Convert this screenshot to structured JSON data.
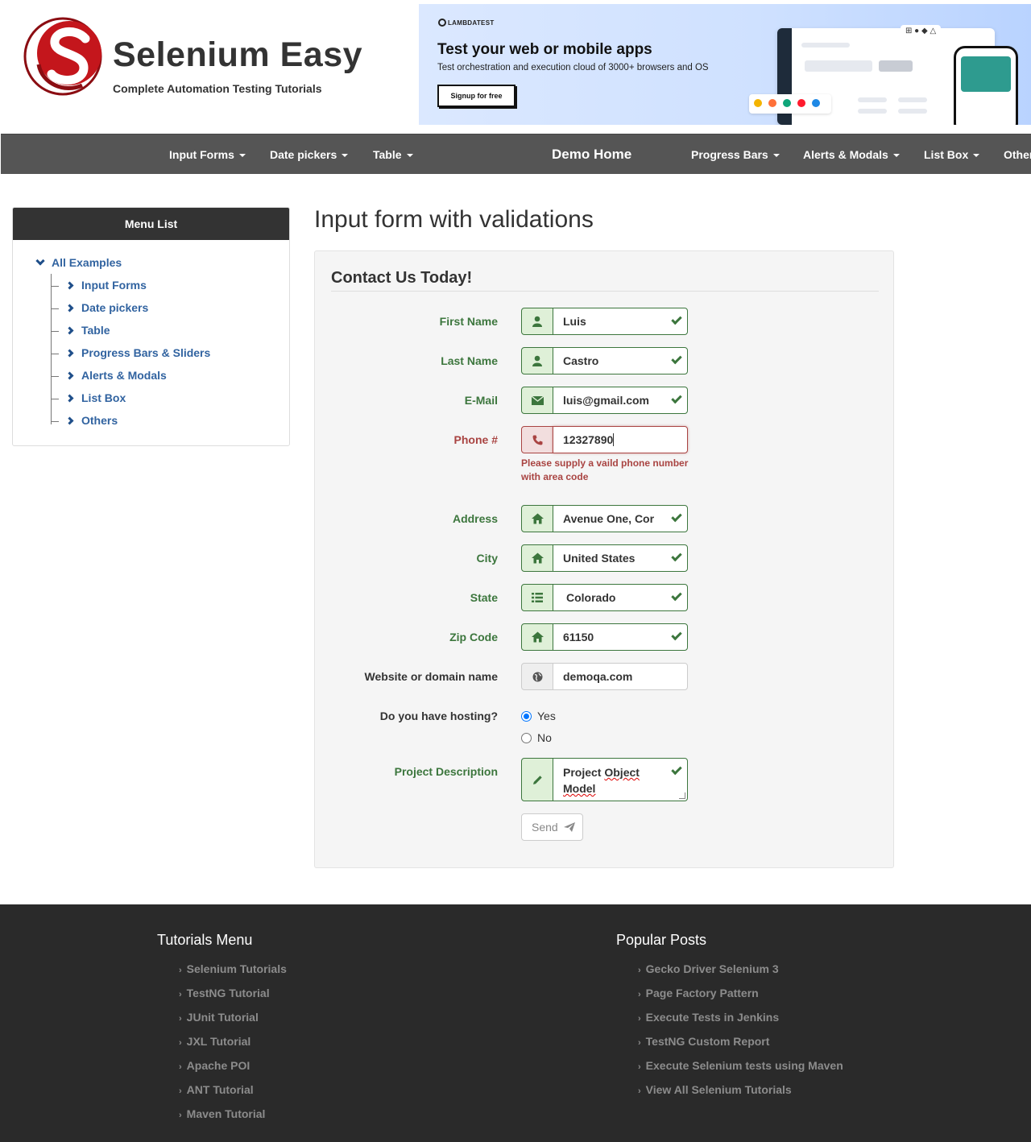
{
  "site": {
    "title": "Selenium Easy",
    "subtitle": "Complete Automation Testing Tutorials"
  },
  "banner": {
    "brand": "LAMBDATEST",
    "title": "Test your web or mobile apps",
    "text": "Test orchestration and execution cloud of 3000+ browsers and OS",
    "button": "Signup for free"
  },
  "nav": {
    "items": [
      "Input Forms",
      "Date pickers",
      "Table",
      "Progress Bars",
      "Alerts & Modals",
      "List Box",
      "Others"
    ],
    "brand": "Demo Home"
  },
  "sidebar": {
    "heading": "Menu List",
    "root": "All Examples",
    "items": [
      "Input Forms",
      "Date pickers",
      "Table",
      "Progress Bars & Sliders",
      "Alerts & Modals",
      "List Box",
      "Others"
    ]
  },
  "form": {
    "page_title": "Input form with validations",
    "legend": "Contact Us Today!",
    "fields": {
      "first_name": {
        "label": "First Name",
        "value": "Luis"
      },
      "last_name": {
        "label": "Last Name",
        "value": "Castro"
      },
      "email": {
        "label": "E-Mail",
        "value": "luis@gmail.com"
      },
      "phone": {
        "label": "Phone #",
        "value": "12327890",
        "error": "Please supply a vaild phone number with area code"
      },
      "address": {
        "label": "Address",
        "value": "Avenue One, Cor"
      },
      "city": {
        "label": "City",
        "value": "United States"
      },
      "state": {
        "label": "State",
        "value": "Colorado"
      },
      "zip": {
        "label": "Zip Code",
        "value": "61150"
      },
      "website": {
        "label": "Website or domain name",
        "value": "demoqa.com"
      },
      "hosting": {
        "label": "Do you have hosting?",
        "options": [
          "Yes",
          "No"
        ],
        "selected": "Yes"
      },
      "description": {
        "label": "Project Description",
        "value_word1": "Project",
        "value_word2": "Object",
        "value_word3": "Model"
      }
    },
    "send_label": "Send"
  },
  "footer": {
    "tutorials_heading": "Tutorials Menu",
    "tutorials": [
      "Selenium Tutorials",
      "TestNG Tutorial",
      "JUnit Tutorial",
      "JXL Tutorial",
      "Apache POI",
      "ANT Tutorial",
      "Maven Tutorial"
    ],
    "posts_heading": "Popular Posts",
    "posts": [
      "Gecko Driver Selenium 3",
      "Page Factory Pattern",
      "Execute Tests in Jenkins",
      "TestNG Custom Report",
      "Execute Selenium tests using Maven",
      "View All Selenium Tutorials"
    ]
  },
  "colors": {
    "navbar": "#555555",
    "success": "#3c763d",
    "error": "#a94442",
    "link": "#3163a0",
    "footer": "#2a2a2a"
  }
}
